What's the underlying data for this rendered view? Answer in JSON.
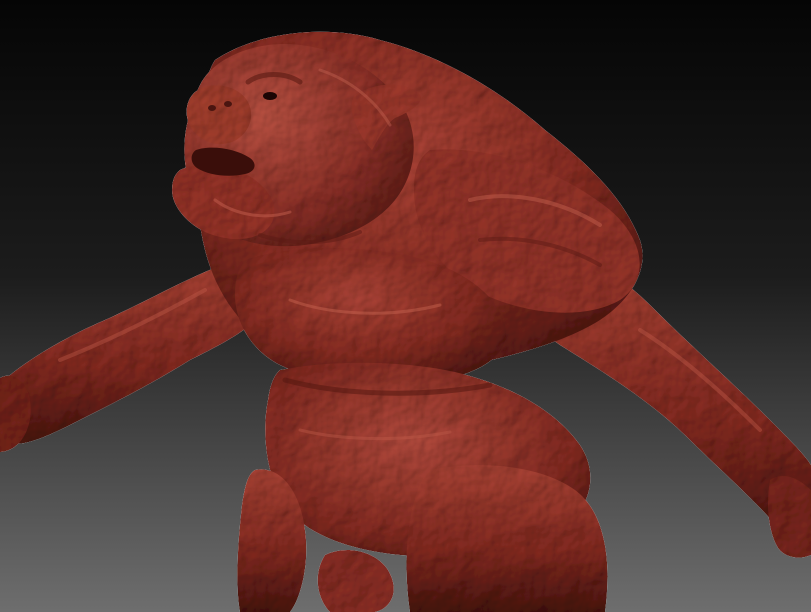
{
  "scene": {
    "subject": "sculpt-creature",
    "material_color": "#8e2f24",
    "highlight_color": "#c85a48",
    "shadow_color": "#4a1510",
    "background_top": "#050505",
    "background_bottom": "#6e6e6e"
  }
}
